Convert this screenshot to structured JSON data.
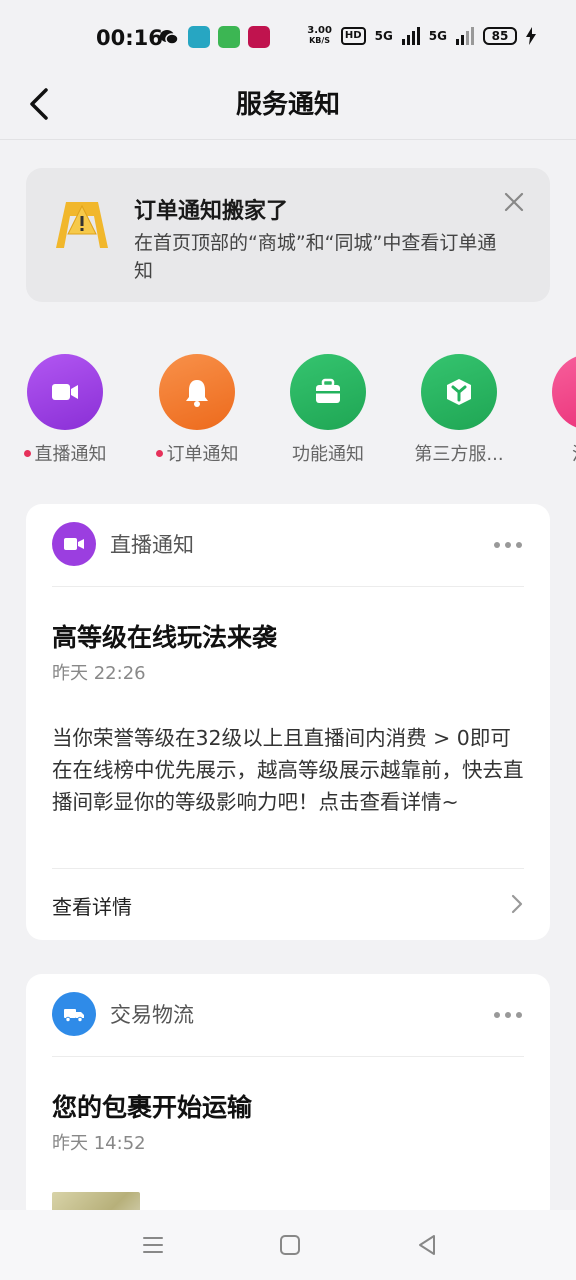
{
  "status_bar": {
    "time": "00:16",
    "net_speed_value": "3.00",
    "net_speed_unit": "KB/S",
    "hd": "HD",
    "sig1": "5G",
    "sig2": "5G",
    "battery": "85"
  },
  "header": {
    "title": "服务通知"
  },
  "banner": {
    "title": "订单通知搬家了",
    "text": "在首页顶部的“商城”和“同城”中查看订单通知"
  },
  "categories": [
    {
      "label": "直播通知",
      "dot": true,
      "color": "#9b3ee0",
      "icon": "video-camera-icon"
    },
    {
      "label": "订单通知",
      "dot": true,
      "color": "#f07b2c",
      "icon": "bell-icon"
    },
    {
      "label": "功能通知",
      "dot": false,
      "color": "#24b35e",
      "icon": "briefcase-icon"
    },
    {
      "label": "第三方服...",
      "dot": false,
      "color": "#24b35e",
      "icon": "cube-icon"
    },
    {
      "label": "活动",
      "dot": false,
      "color": "#f0448a",
      "icon": "activity-icon"
    }
  ],
  "cards": [
    {
      "category": "直播通知",
      "title": "高等级在线玩法来袭",
      "time": "昨天 22:26",
      "body": "当你荣誉等级在32级以上且直播间内消费 > 0即可在在线榜中优先展示，越高等级展示越靠前，快去直播间彰显你的等级影响力吧！点击查看详情~",
      "link": "查看详情"
    },
    {
      "category": "交易物流",
      "title": "您的包裹开始运输",
      "time": "昨天 14:52"
    }
  ],
  "colors": {
    "background": "#f2f2f4",
    "card": "#ffffff",
    "live_purple": "#9b3ee0",
    "order_orange": "#f07b2c",
    "green": "#24b35e",
    "pink": "#f0448a",
    "logistics_blue": "#2f8be8",
    "red_dot": "#e6315a"
  }
}
